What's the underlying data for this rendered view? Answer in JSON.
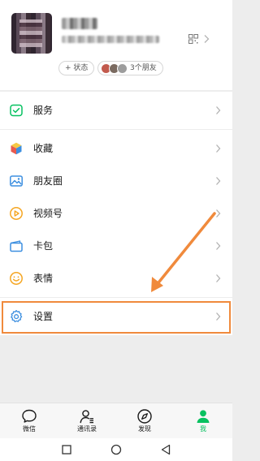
{
  "profile": {
    "status_label": "+ 状态",
    "friends_label": "3个朋友"
  },
  "menu": {
    "service": "服务",
    "favorites": "收藏",
    "moments": "朋友圈",
    "channels": "视频号",
    "cards": "卡包",
    "stickers": "表情",
    "settings": "设置"
  },
  "tabs": {
    "chats": "微信",
    "contacts": "通讯录",
    "discover": "发现",
    "me": "我"
  },
  "colors": {
    "accent_green": "#07c160",
    "highlight_orange": "#f08a3c"
  }
}
